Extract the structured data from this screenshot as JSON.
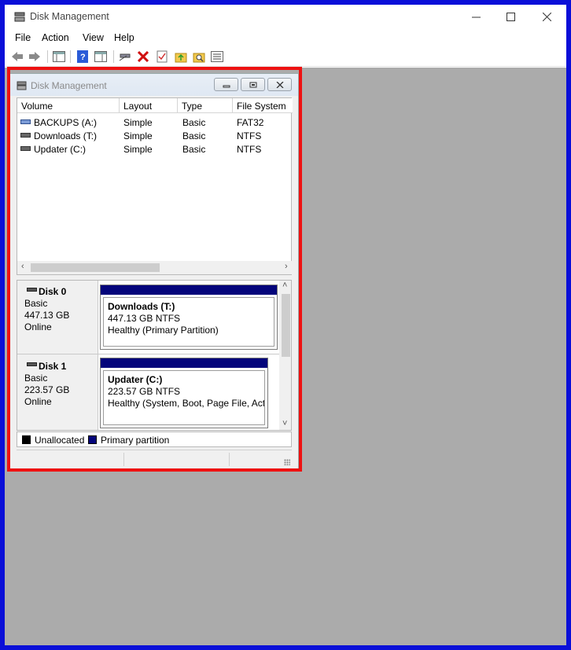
{
  "window": {
    "title": "Disk Management",
    "minimize_glyph": "—",
    "maximize_glyph": "☐",
    "close_glyph": "✕"
  },
  "menu": {
    "file": "File",
    "action": "Action",
    "view": "View",
    "help": "Help"
  },
  "toolbar": {
    "icons": [
      "back-icon",
      "forward-icon",
      "show-hide-console-tree-icon",
      "help-icon",
      "properties-icon",
      "connect-disk-icon",
      "delete-icon",
      "check-icon",
      "folder-up-icon",
      "search-folder-icon",
      "settings-list-icon"
    ],
    "accent_delete": "#d01010"
  },
  "inner_window": {
    "title": "Disk Management"
  },
  "volume_table": {
    "headers": [
      "Volume",
      "Layout",
      "Type",
      "File System"
    ],
    "rows": [
      {
        "volume": "BACKUPS (A:)",
        "layout": "Simple",
        "type": "Basic",
        "fs": "FAT32"
      },
      {
        "volume": "Downloads (T:)",
        "layout": "Simple",
        "type": "Basic",
        "fs": "NTFS"
      },
      {
        "volume": "Updater (C:)",
        "layout": "Simple",
        "type": "Basic",
        "fs": "NTFS"
      }
    ]
  },
  "disks": [
    {
      "name": "Disk 0",
      "kind": "Basic",
      "size": "447.13 GB",
      "status": "Online",
      "partition": {
        "name": "Downloads  (T:)",
        "size_fs": "447.13 GB NTFS",
        "health": "Healthy (Primary Partition)"
      }
    },
    {
      "name": "Disk 1",
      "kind": "Basic",
      "size": "223.57 GB",
      "status": "Online",
      "partition": {
        "name": "Updater  (C:)",
        "size_fs": "223.57 GB NTFS",
        "health": "Healthy (System, Boot, Page File, Activ"
      }
    }
  ],
  "legend": {
    "unallocated": "Unallocated",
    "primary": "Primary partition",
    "unallocated_color": "#000000",
    "primary_color": "#04057b"
  },
  "colors": {
    "frame_border": "#0a0fd8",
    "highlight": "#ee1111",
    "mdi_background": "#ababab"
  }
}
